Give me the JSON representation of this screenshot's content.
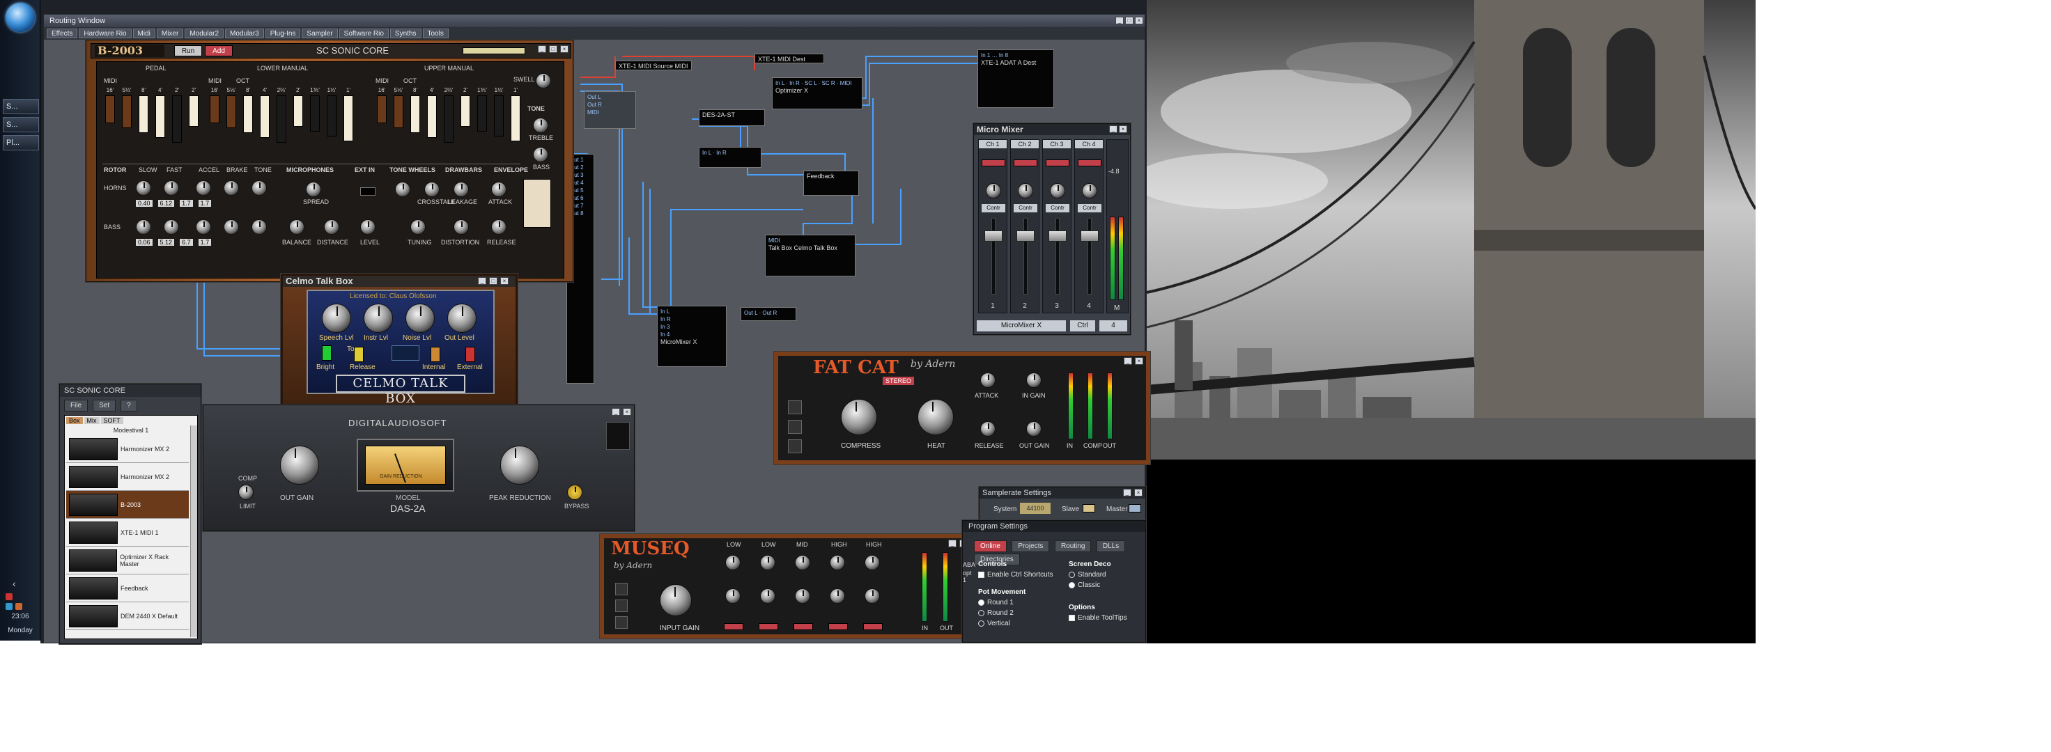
{
  "taskbar": {
    "buttons": [
      "S...",
      "S...",
      "Pl..."
    ],
    "time": "23:06",
    "day": "Monday"
  },
  "routing_window": {
    "title": "Routing Window",
    "menu": [
      "Effects",
      "Hardware Rio",
      "Midi",
      "Mixer",
      "Modular2",
      "Modular3",
      "Plug-Ins",
      "Sampler",
      "Software Rio",
      "Synths",
      "Tools"
    ]
  },
  "b2003": {
    "name": "B-2003",
    "brand": "SC SONIC CORE",
    "btn_run": "Run",
    "btn_add": "Add",
    "pedal_label": "PEDAL",
    "lower_label": "LOWER MANUAL",
    "upper_label": "UPPER MANUAL",
    "swell": "SWELL",
    "tone": "TONE",
    "treble": "TREBLE",
    "bass": "BASS",
    "midi": "MIDI",
    "oct": "OCT",
    "pedal_footages": [
      "16'",
      "5⅓'",
      "8'",
      "4'",
      "2'",
      "2'"
    ],
    "manual_footages": [
      "16'",
      "5⅓'",
      "8'",
      "4'",
      "2⅔'",
      "2'",
      "1⅗'",
      "1⅓'",
      "1'"
    ],
    "sections": [
      "ROTOR",
      "MICROPHONES",
      "EXT IN",
      "TONE WHEELS",
      "DRAWBARS",
      "ENVELOPE"
    ],
    "rotor_controls": [
      "SLOW",
      "FAST",
      "ACCEL",
      "BRAKE",
      "TONE"
    ],
    "row_horns": "HORNS",
    "row_bass": "BASS",
    "spread": "SPREAD",
    "balance": "BALANCE",
    "distance": "DISTANCE",
    "level": "LEVEL",
    "tuning": "TUNING",
    "distortion": "DISTORTION",
    "leakage": "LEAKAGE",
    "attack": "ATTACK",
    "release": "RELEASE",
    "crosstalk": "CROSSTALK",
    "horns_values": [
      "0.40",
      "6.12",
      "1.7",
      "1.7"
    ],
    "bass_values": [
      "0.06",
      "5.12",
      "6.7",
      "1.7"
    ]
  },
  "talkbox": {
    "title": "Celmo Talk Box",
    "licensed": "Licensed to: Claus Olofsson",
    "knobs": [
      "Speech Lvl",
      "Instr Lvl",
      "Noise Lvl",
      "Out Level"
    ],
    "switches": [
      "Bright",
      "Release",
      "Internal",
      "External"
    ],
    "mode_label": "Tone",
    "logo": "CELMO TALK BOX"
  },
  "sonic_core_panel": {
    "title": "SC SONIC CORE",
    "tabs": [
      "File",
      "Set",
      "?"
    ],
    "filter_tabs": [
      "Box",
      "Mix",
      "SOFT"
    ],
    "header": "Modestival 1",
    "items": [
      "Harmonizer MX 2",
      "Harmonizer MX 2",
      "B-2003",
      "XTE-1 MIDI 1",
      "Optimizer X Rack Master",
      "Feedback",
      "DEM 2440 X Default"
    ]
  },
  "das2a": {
    "brand": "DIGITALAUDIOSOFT",
    "model_label": "MODEL",
    "model": "DAS-2A",
    "meter_label": "GAIN REDUCTION",
    "out_gain": "OUT GAIN",
    "peak_reduction": "PEAK REDUCTION",
    "comp": "COMP",
    "limit": "LIMIT",
    "bypass": "BYPASS"
  },
  "fatcat": {
    "name": "FAT CAT",
    "by": "by Adern",
    "badge": "STEREO",
    "knobs": [
      "COMPRESS",
      "HEAT",
      "ATTACK",
      "IN GAIN",
      "RELEASE",
      "OUT GAIN"
    ],
    "meters": [
      "IN",
      "COMP",
      "OUT"
    ]
  },
  "museq": {
    "name": "MUSEQ",
    "by": "by Adern",
    "bands": [
      "LOW",
      "LOW",
      "MID",
      "HIGH",
      "HIGH"
    ],
    "input_gain": "INPUT GAIN",
    "meters": [
      "IN",
      "OUT"
    ]
  },
  "micromixer": {
    "title": "Micro Mixer",
    "channels": [
      {
        "name": "Ch 1",
        "label": "Contr",
        "num": "1"
      },
      {
        "name": "Ch 2",
        "label": "Contr",
        "num": "2"
      },
      {
        "name": "Ch 3",
        "label": "Contr",
        "num": "3"
      },
      {
        "name": "Ch 4",
        "label": "Contr",
        "num": "4"
      }
    ],
    "master_label": "M",
    "master_value": "-4.8",
    "footer_name": "MicroMixer X",
    "footer_ctrl": "Ctrl",
    "footer_num": "4"
  },
  "routing_boxes": [
    {
      "label": "XTE-1 MIDI Source MIDI"
    },
    {
      "label": "XTE-1 MIDI Dest"
    },
    {
      "label": "Optimizer X"
    },
    {
      "label": "XTE-1 ADAT A Dest"
    },
    {
      "label": "DES-2A-ST"
    },
    {
      "label": "Talk Box Celmo Talk Box"
    },
    {
      "label": "MicroMixer X"
    },
    {
      "label": "Fat Cat"
    },
    {
      "label": "Museq"
    },
    {
      "label": "Feedback"
    }
  ],
  "sampler_settings": {
    "title": "Samplerate Settings",
    "system": "System",
    "system_value": "44100",
    "slave": "Slave",
    "master": "Master"
  },
  "program_settings": {
    "title": "Program Settings",
    "tabs": [
      "Online",
      "Projects",
      "Routing",
      "DLLs",
      "Directories"
    ],
    "controls_head": "Controls",
    "enable_shortcuts": "Enable Ctrl Shortcuts",
    "screen_head": "Screen Deco",
    "standard": "Standard",
    "classic": "Classic",
    "pot_head": "Pot Movement",
    "pot_options": [
      "Round 1",
      "Round 2",
      "Vertical"
    ],
    "options_head": "Options",
    "enable_tooltips": "Enable ToolTips",
    "side_labels": [
      "ABA",
      "opt 1"
    ]
  },
  "colors": {
    "accent_red": "#c2404a",
    "cable_blue": "#4aa0ff",
    "cable_red": "#e04030",
    "wood": "#a85e2a"
  }
}
